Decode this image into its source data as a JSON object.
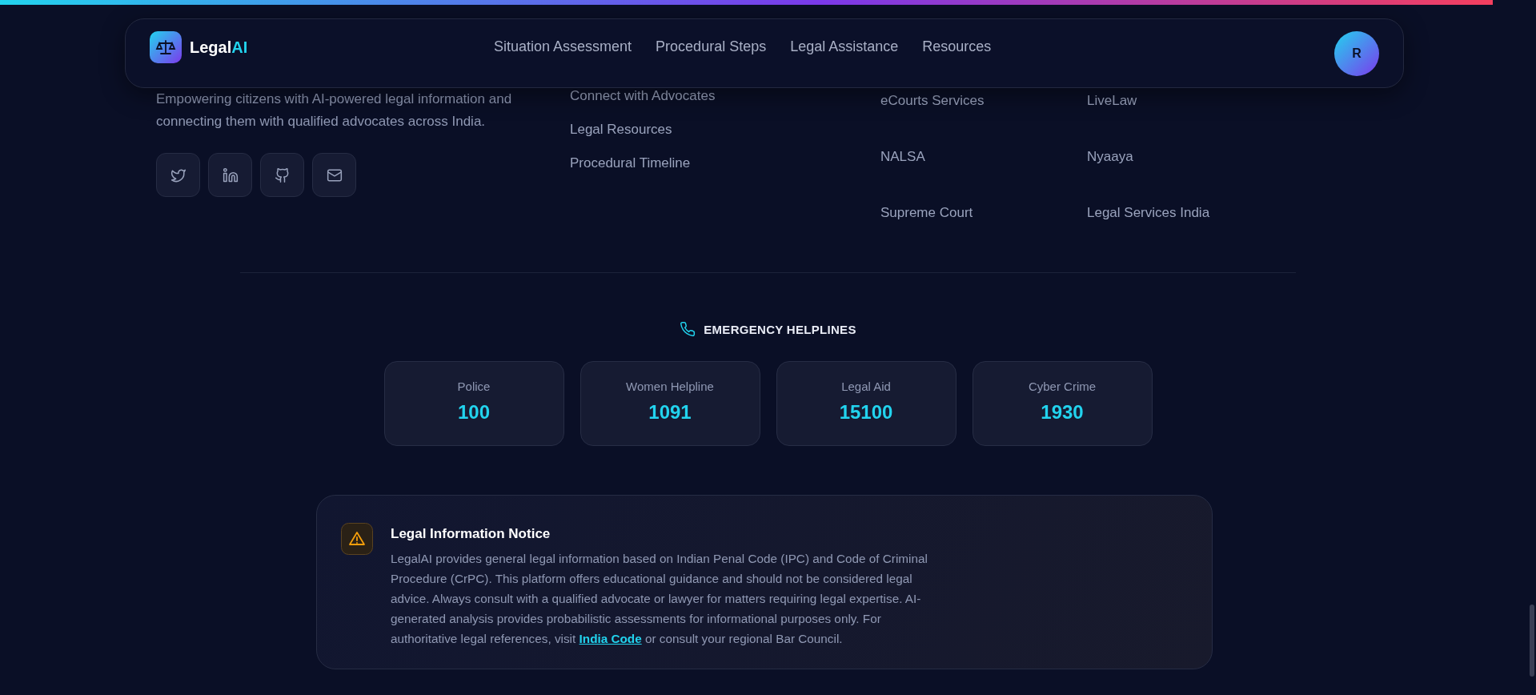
{
  "header": {
    "brand": {
      "name": "Legal",
      "accent": "AI"
    },
    "nav": [
      "Situation Assessment",
      "Procedural Steps",
      "Legal Assistance",
      "Resources"
    ],
    "avatar": "R"
  },
  "footer": {
    "description": "Empowering citizens with AI-powered legal information and connecting them with qualified advocates across India.",
    "social": [
      {
        "kind": "twitter"
      },
      {
        "kind": "linkedin"
      },
      {
        "kind": "github"
      },
      {
        "kind": "mail"
      }
    ],
    "quick_links": [
      "Connect with Advocates",
      "Legal Resources",
      "Procedural Timeline"
    ],
    "resources_left": [
      "eCourts Services",
      "NALSA",
      "Supreme Court"
    ],
    "resources_right": [
      "LiveLaw",
      "Nyaaya",
      "Legal Services India"
    ]
  },
  "emergency": {
    "title": "EMERGENCY HELPLINES",
    "helplines": [
      {
        "label": "Police",
        "number": "100"
      },
      {
        "label": "Women Helpline",
        "number": "1091"
      },
      {
        "label": "Legal Aid",
        "number": "15100"
      },
      {
        "label": "Cyber Crime",
        "number": "1930"
      }
    ]
  },
  "notice": {
    "title": "Legal Information Notice",
    "text_before": "LegalAI provides general legal information based on Indian Penal Code (IPC) and Code of Criminal Procedure (CrPC). This platform offers educational guidance and should not be considered legal advice. Always consult with a qualified advocate or lawyer for matters requiring legal expertise. AI-generated analysis provides probabilistic assessments for informational purposes only. For authoritative legal references, visit",
    "link": "India Code",
    "text_after": "or consult your regional Bar Council."
  }
}
